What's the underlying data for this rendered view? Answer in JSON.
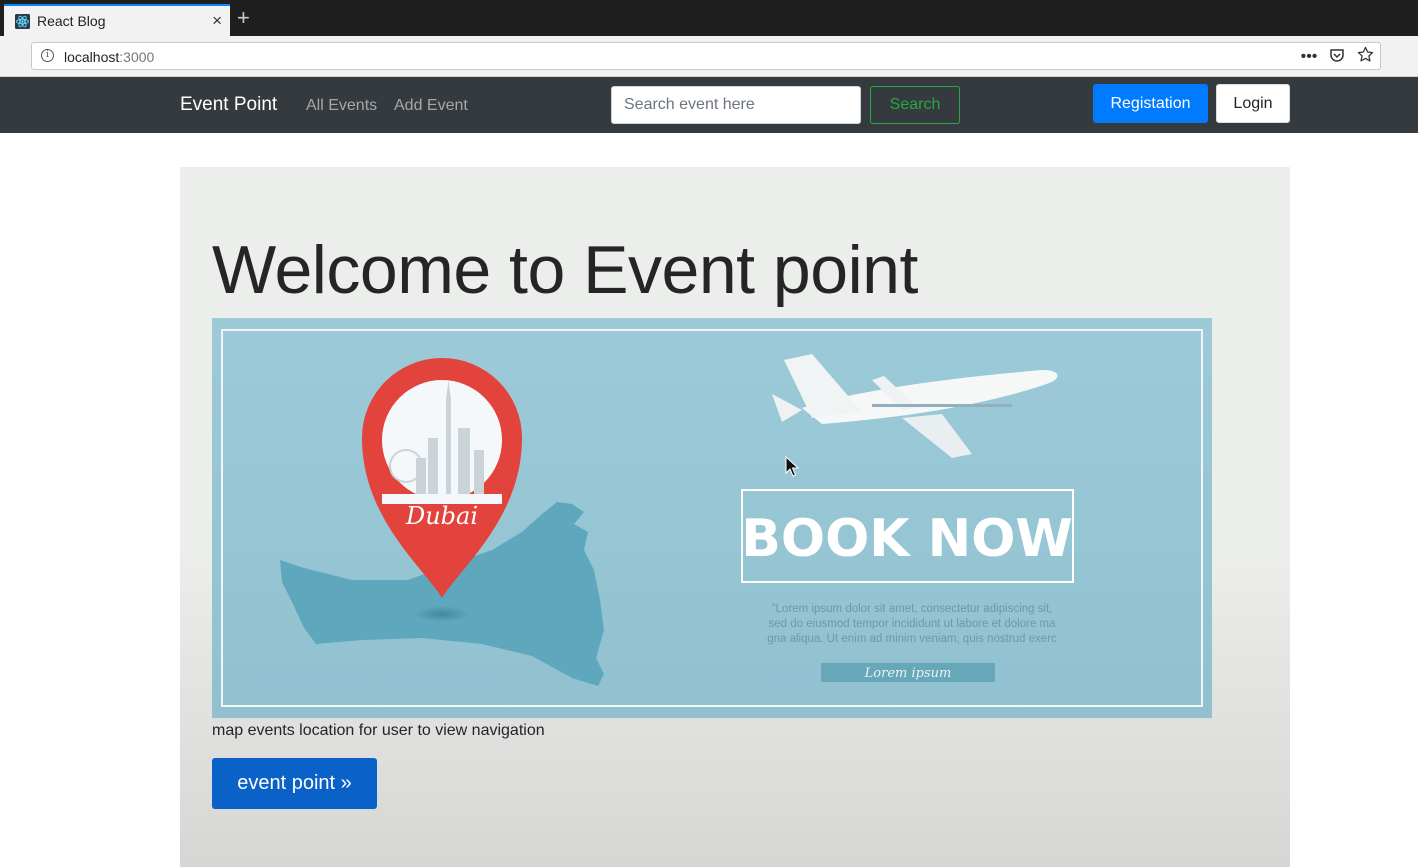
{
  "browser": {
    "tab_title": "React Blog",
    "tab_close": "×",
    "new_tab": "+",
    "url_host": "localhost",
    "url_port": ":3000",
    "url_actions": [
      "more-icon",
      "pocket-icon",
      "bookmark-star-icon"
    ]
  },
  "navbar": {
    "brand": "Event Point",
    "links": [
      "All Events",
      "Add Event"
    ],
    "search_placeholder": "Search event here",
    "search_button": "Search",
    "register_button": "Registation",
    "login_button": "Login"
  },
  "hero": {
    "title": "Welcome to Event point",
    "banner": {
      "pin_label": "Dubai",
      "book_now": "BOOK NOW",
      "lorem_lines": [
        "\"Lorem ipsum dolor sit amet, consectetur adipiscing sit,",
        "sed do eiusmod tempor incididunt ut labore et dolore ma",
        "gna aliqua. Ut enim ad minim veniam, quis nostrud exerc"
      ],
      "lorem_button": "Lorem ipsum"
    },
    "caption": "map events location for user to view navigation",
    "cta_button": "event point »"
  },
  "colors": {
    "navbar_bg": "#353a3f",
    "primary": "#007bff",
    "success": "#28a745",
    "banner_bg": "#98c7d6",
    "pin_red": "#e2433c"
  }
}
